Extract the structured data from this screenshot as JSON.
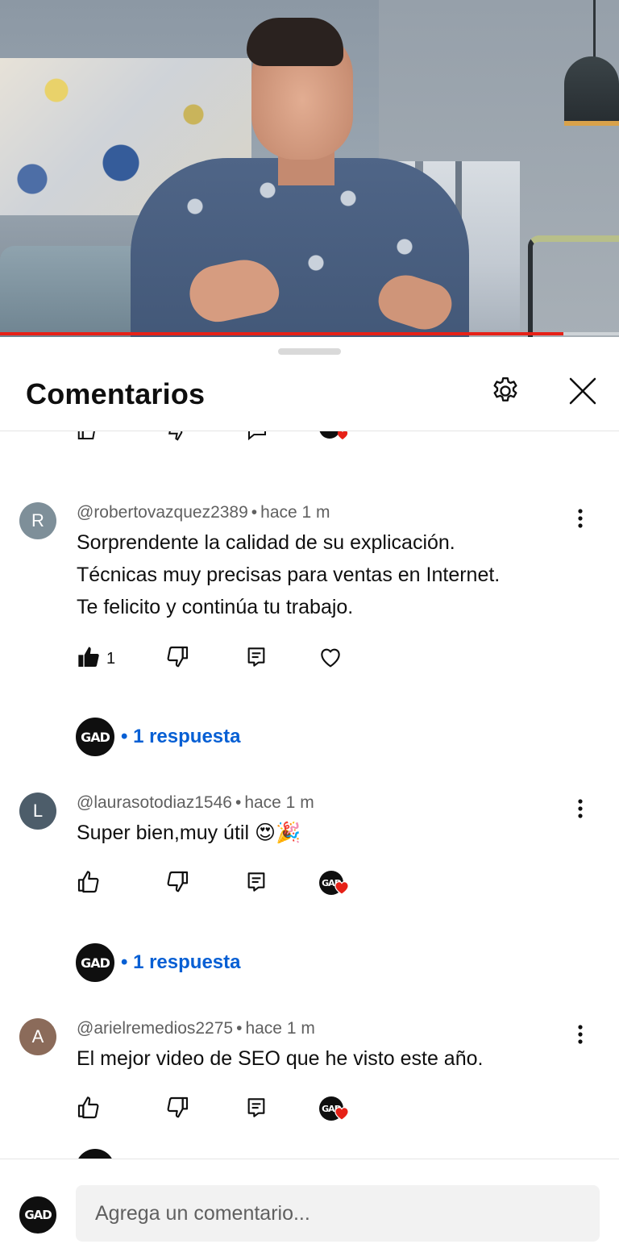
{
  "video": {
    "progress_percent": 91
  },
  "sheet": {
    "title": "Comentarios",
    "settings_icon": "gear-icon",
    "close_icon": "close-icon"
  },
  "comments": [
    {
      "avatar_letter": "R",
      "avatar_color": "#7e8f99",
      "author": "@robertovazquez2389",
      "time": "hace 1 m",
      "lines": [
        "Sorprendente la calidad de su explicación.",
        "Técnicas muy precisas para ventas en Internet.",
        "Te felicito y continúa tu trabajo."
      ],
      "like_count": "1",
      "liked": true,
      "creator_hearted": false,
      "creator_avatar_text": "GAD",
      "replies_label": "• 1 respuesta"
    },
    {
      "avatar_letter": "L",
      "avatar_color": "#4d5d6a",
      "author": "@laurasotodiaz1546",
      "time": "hace 1 m",
      "lines": [
        "Super bien,muy útil 😍🎉"
      ],
      "like_count": "",
      "liked": false,
      "creator_hearted": true,
      "creator_avatar_text": "GAD",
      "replies_label": "• 1 respuesta"
    },
    {
      "avatar_letter": "A",
      "avatar_color": "#8b6b5a",
      "author": "@arielremedios2275",
      "time": "hace 1 m",
      "lines": [
        "El mejor video de SEO que he visto este año."
      ],
      "like_count": "",
      "liked": false,
      "creator_hearted": true,
      "creator_avatar_text": "GAD"
    }
  ],
  "composer": {
    "avatar_text": "GAD",
    "placeholder": "Agrega un comentario..."
  }
}
